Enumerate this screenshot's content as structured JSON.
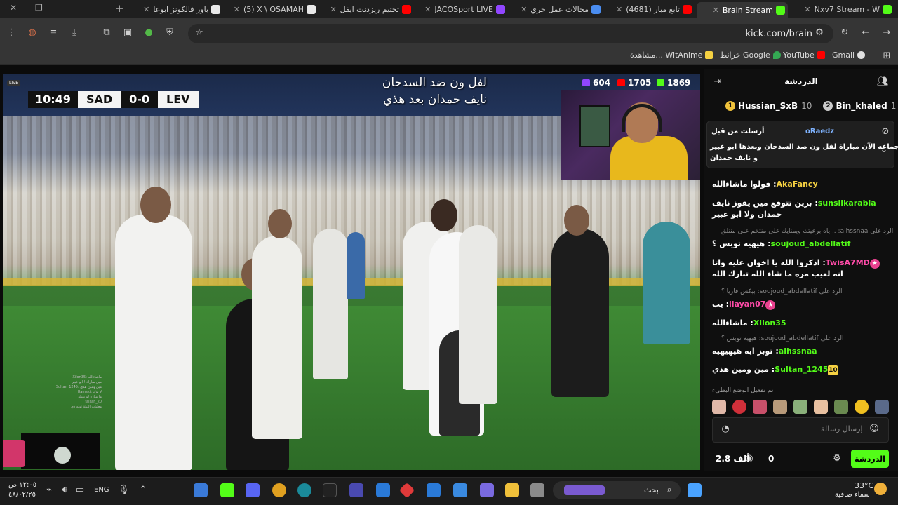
{
  "browser": {
    "tabs": [
      {
        "label": "Nxv7 Stream - W",
        "favicon_color": "#53fc18",
        "active": false
      },
      {
        "label": "Brain Stream",
        "favicon_color": "#53fc18",
        "active": true
      },
      {
        "label": "(4681) تابع مبار",
        "favicon_color": "#ff0000",
        "active": false
      },
      {
        "label": "مجالات عمل خري",
        "favicon_color": "#4a8df0",
        "active": false
      },
      {
        "label": "JACOSport LIVE",
        "favicon_color": "#9146ff",
        "active": false
      },
      {
        "label": "تحتيم ريزدنت ايفل",
        "favicon_color": "#ff0000",
        "active": false
      },
      {
        "label": "(5) X \\ OSAMAH",
        "favicon_color": "#ffffff",
        "active": false
      },
      {
        "label": "باور فالكونز ابوعا",
        "favicon_color": "#ffffff",
        "active": false
      }
    ],
    "url": "kick.com/brain",
    "bookmarks": [
      {
        "label": "Gmail",
        "color": "#e0e0e0"
      },
      {
        "label": "YouTube",
        "color": "#ff0000"
      },
      {
        "label": "خرائط Google",
        "color": "#34a853"
      },
      {
        "label": "مشاهدة... WitAnime",
        "color": "#f5d142"
      }
    ]
  },
  "video": {
    "scoreboard": {
      "time": "10:49",
      "home": "SAD",
      "score": "0-0",
      "away": "LEV"
    },
    "live_badge": "LIVE",
    "overlay_line1": "لفل ون ضد السدحان",
    "overlay_line2": "نايف حمدان بعد هذي",
    "stats": {
      "kick": "1869",
      "youtube": "1705",
      "twitch": "604"
    },
    "mini_chat": [
      "ماشاءالله :Xilon35",
      "مين مباراة ! ابو عبير",
      "مين ومين هذي :Sultan_1245",
      "لا يوك :Ramski",
      "ما مباره لو نفيله",
      "faisan_k0",
      "معليات الليلة توله ذي"
    ]
  },
  "chat": {
    "title": "الدردشة",
    "top_gifters": [
      {
        "rank": "1",
        "name": "Hussian_SxB",
        "count": "10"
      },
      {
        "rank": "2",
        "name": "Bin_khaled",
        "count": "1"
      }
    ],
    "pinned": {
      "label": "أرسلت من قبل",
      "user": "oRaedz",
      "text_line1": "يا جماعه الآن مباراة لفل ون ضد السدحان وبعدها ابو عبير",
      "text_line2": "و نايف حمدان"
    },
    "messages": [
      {
        "user": "AkaFancy",
        "user_color": "#f5d142",
        "text": "قولوا ماشاءالله"
      },
      {
        "user": "sunsilkarabia",
        "user_color": "#53fc18",
        "text": "برين تتوقع مين يفوز نايف حمدان ولا ابو عبير"
      },
      {
        "user": "soujoud_abdellatif",
        "user_color": "#53fc18",
        "text": "هيهيه توبس ؟",
        "reply": "الرد على alhssnaa: ...ياه برعيتك ويمنايك على منتخم على منتلق"
      },
      {
        "user": "TwisA7MD",
        "user_color": "#ff4ba8",
        "text": "اذكروا الله يا اخوان عليه واتا انه لعيب مره ما شاء الله تبارك الله"
      },
      {
        "user": "ilayan07",
        "user_color": "#ff4ba8",
        "text": "يب",
        "reply": "الرد على soujoud_abdellatif: بيكس فاريا ؟"
      },
      {
        "user": "Xilon35",
        "user_color": "#53fc18",
        "text": "ماشاءالله"
      },
      {
        "user": "alhssnaa",
        "user_color": "#53fc18",
        "text": "توبز ايه هيهيهيه",
        "reply": "الرد على soujoud_abdellatif: هيهيه توبس ؟"
      },
      {
        "user": "Sultan_1245",
        "user_color": "#53fc18",
        "text": "مين ومين هذي",
        "badge": "10"
      }
    ],
    "emote_hint": "تم تفعيل الوضع البطيء",
    "input_placeholder": "إرسال رسالة",
    "send_label": "الدردشة",
    "points": "0",
    "viewers": "2.8 ألف"
  },
  "taskbar": {
    "weather_temp": "33°C",
    "weather_text": "سماء صافية",
    "search_placeholder": "بحث",
    "language": "ENG",
    "time": "١٢:٠٥ ص",
    "date": "٤٨/٠٢/٢٥"
  }
}
